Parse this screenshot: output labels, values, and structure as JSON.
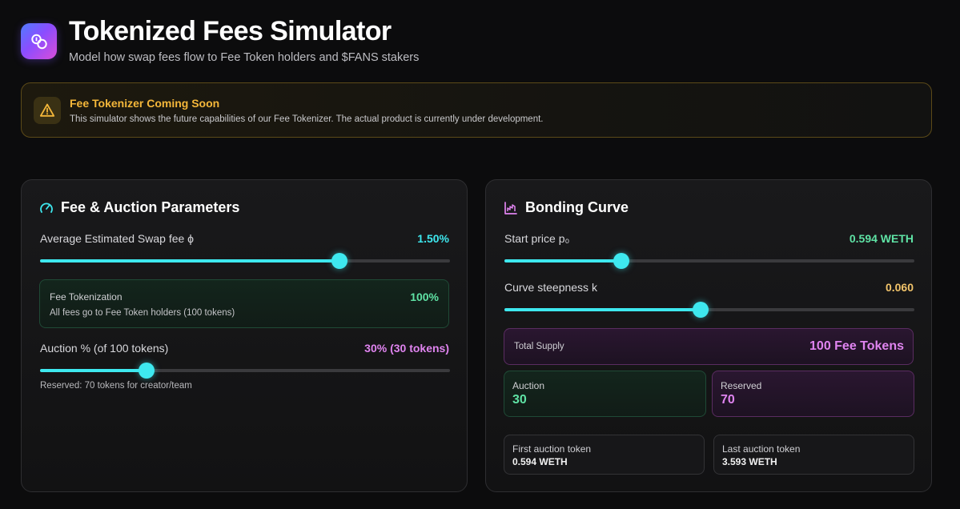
{
  "header": {
    "title": "Tokenized Fees Simulator",
    "subtitle": "Model how swap fees flow to Fee Token holders and $FANS stakers",
    "logo_icon": "coins-icon"
  },
  "banner": {
    "icon": "warning-icon",
    "title": "Fee Tokenizer Coming Soon",
    "text": "This simulator shows the future capabilities of our Fee Tokenizer. The actual product is currently under development."
  },
  "fee_panel": {
    "icon": "gauge-icon",
    "title": "Fee & Auction Parameters",
    "swap_fee": {
      "label": "Average Estimated Swap fee ϕ",
      "value": "1.50%",
      "slider_fraction": 0.73
    },
    "tokenization": {
      "title": "Fee Tokenization",
      "value": "100%",
      "description": "All fees go to Fee Token holders (100 tokens)"
    },
    "auction": {
      "label": "Auction % (of 100 tokens)",
      "value": "30% (30 tokens)",
      "slider_fraction": 0.259
    },
    "reserved_note": "Reserved: 70 tokens for creator/team"
  },
  "curve_panel": {
    "icon": "chart-icon",
    "title": "Bonding Curve",
    "start_price": {
      "label": "Start price p₀",
      "value": "0.594 WETH",
      "slider_fraction": 0.285
    },
    "steepness": {
      "label": "Curve steepness k",
      "value": "0.060",
      "slider_fraction": 0.479
    },
    "total_supply": {
      "label": "Total Supply",
      "value": "100 Fee Tokens"
    },
    "auction": {
      "label": "Auction",
      "value": "30"
    },
    "reserved": {
      "label": "Reserved",
      "value": "70"
    },
    "first_token": {
      "label": "First auction token",
      "value": "0.594 WETH"
    },
    "last_token": {
      "label": "Last auction token",
      "value": "3.593 WETH"
    }
  },
  "colors": {
    "accent_cyan": "#3ee8ef",
    "green": "#5fe3a5",
    "purple": "#e084f0",
    "amber": "#f4b73a",
    "yellow": "#f2c46a"
  }
}
